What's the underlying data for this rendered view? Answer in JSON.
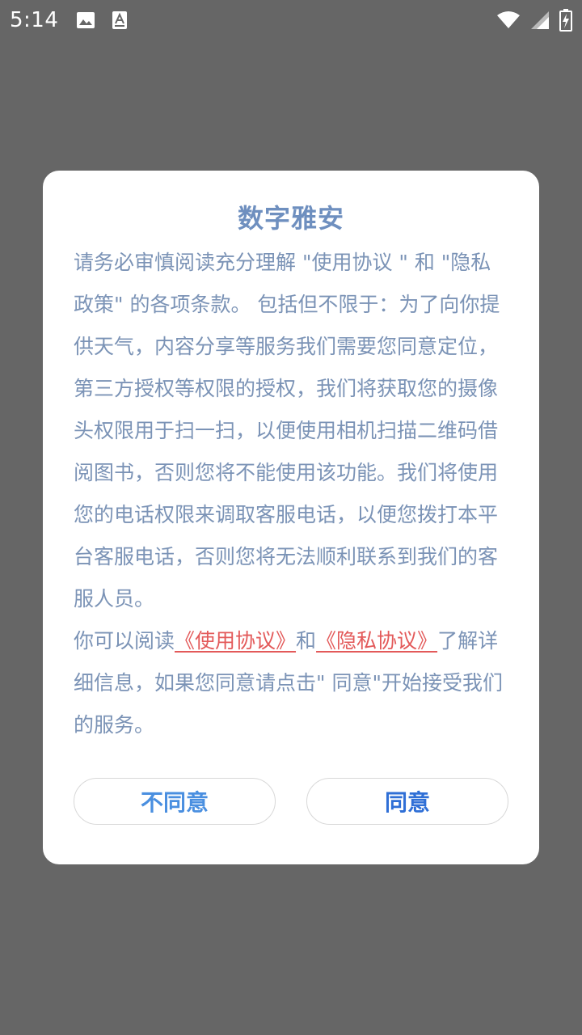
{
  "status_bar": {
    "time": "5:14",
    "icons": [
      "image-icon",
      "text-a-icon",
      "wifi-icon",
      "signal-icon",
      "battery-charging-icon"
    ]
  },
  "dialog": {
    "title": "数字雅安",
    "paragraph1": "请务必审慎阅读充分理解 \"使用协议 \" 和 \"隐私政策\" 的各项条款。 包括但不限于：为了向你提供天气，内容分享等服务我们需要您同意定位，第三方授权等权限的授权，我们将获取您的摄像头权限用于扫一扫，以便使用相机扫描二维码借阅图书，否则您将不能使用该功能。我们将使用您的电话权限来调取客服电话，以便您拨打本平台客服电话，否则您将无法顺利联系到我们的客服人员。",
    "p2_prefix": "你可以阅读",
    "link_usage": "《使用协议》",
    "p2_and": "和",
    "link_privacy": "《隐私协议》",
    "p2_suffix": "了解详细信息，如果您同意请点击\" 同意\"开始接受我们的服务。",
    "disagree_label": "不同意",
    "agree_label": "同意"
  },
  "colors": {
    "overlay": "#666666",
    "title": "#6e8fbf",
    "body_text": "#7b93b6",
    "link": "#e35a5a",
    "button_text": "#2f6fd6"
  }
}
